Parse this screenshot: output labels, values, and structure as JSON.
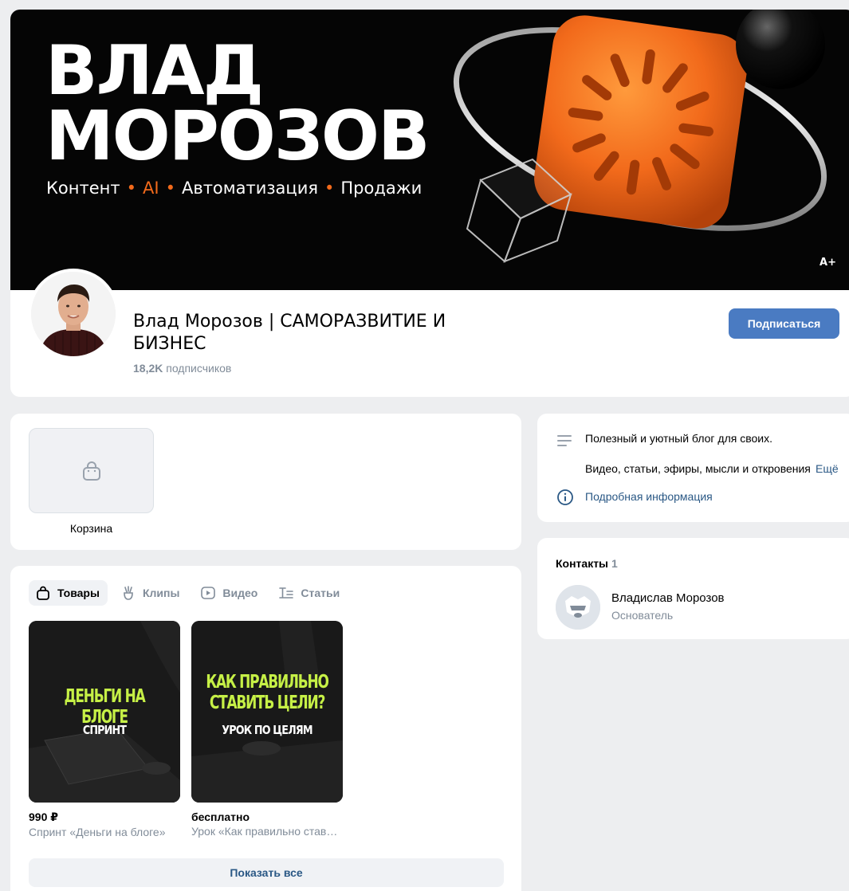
{
  "cover": {
    "title_line1": "ВЛАД",
    "title_line2": "МОРОЗОВ",
    "tags": [
      "Контент",
      "AI",
      "Автоматизация",
      "Продажи"
    ],
    "badge": "A+",
    "accent_color": "#f26a1b"
  },
  "profile": {
    "name": "Влад Морозов | САМОРАЗВИТИЕ И БИЗНЕС",
    "subscribers_count": "18,2K",
    "subscribers_label": "подписчиков",
    "subscribe_label": "Подписаться",
    "button_color": "#4a7bc2"
  },
  "cart": {
    "label": "Корзина",
    "icon": "shopping-bag-icon"
  },
  "about": {
    "line1": "Полезный и уютный блог для своих.",
    "line2": "Видео, статьи, эфиры, мысли и откровения",
    "more": "Ещё",
    "info_link": "Подробная информация"
  },
  "contacts": {
    "title": "Контакты",
    "count": "1",
    "items": [
      {
        "name": "Владислав Морозов",
        "role": "Основатель"
      }
    ]
  },
  "products": {
    "tabs": [
      {
        "label": "Товары",
        "icon": "shopping-bag-icon",
        "active": true
      },
      {
        "label": "Клипы",
        "icon": "clips-icon",
        "active": false
      },
      {
        "label": "Видео",
        "icon": "video-icon",
        "active": false
      },
      {
        "label": "Статьи",
        "icon": "articles-icon",
        "active": false
      }
    ],
    "items": [
      {
        "headline": "ДЕНЬГИ НА БЛОГЕ",
        "subtitle": "СПРИНТ",
        "price": "990 ₽",
        "name": "Спринт «Деньги на блоге»"
      },
      {
        "headline": "КАК ПРАВИЛЬНО СТАВИТЬ ЦЕЛИ?",
        "subtitle": "УРОК ПО ЦЕЛЯМ",
        "price": "бесплатно",
        "name": "Урок «Как правильно ставить цели»"
      }
    ],
    "show_all": "Показать все"
  }
}
